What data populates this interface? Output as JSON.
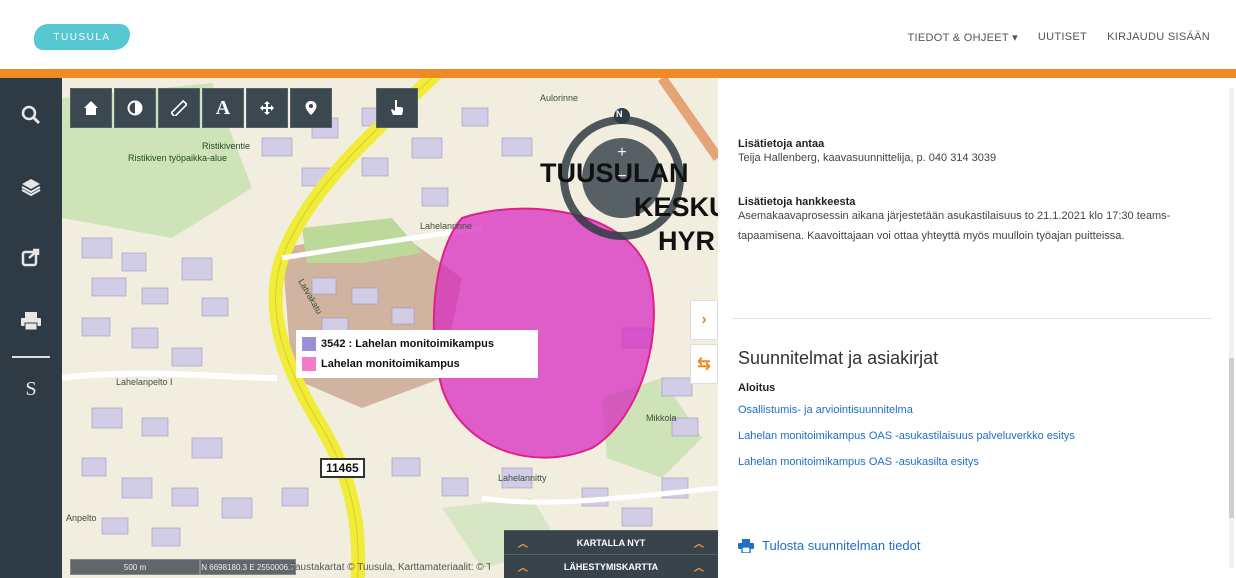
{
  "header": {
    "logo_text": "TUUSULA",
    "nav": [
      {
        "label": "TIEDOT & OHJEET ▾"
      },
      {
        "label": "UUTISET"
      },
      {
        "label": "KIRJAUDU SISÄÄN"
      }
    ],
    "accent_color": "#f08a24"
  },
  "sidebar": {
    "items": [
      {
        "icon": "search-icon"
      },
      {
        "icon": "layers-icon"
      },
      {
        "icon": "share-icon"
      },
      {
        "icon": "print-icon"
      },
      {
        "icon": "s-icon",
        "label": "S"
      }
    ]
  },
  "map": {
    "toolbar": [
      {
        "icon": "home-icon"
      },
      {
        "icon": "contrast-icon"
      },
      {
        "icon": "ruler-icon"
      },
      {
        "icon": "text-tool-icon",
        "label": "A"
      },
      {
        "icon": "move-icon"
      },
      {
        "icon": "location-pin-icon"
      },
      {
        "icon": "hand-pointer-icon"
      }
    ],
    "compass_label": "N",
    "place_labels": [
      "TUUSULAN",
      "KESKUS",
      "HYR"
    ],
    "small_labels": [
      "Ristikiven työpaikka-alue",
      "Ristikiventie",
      "Aulorinne",
      "Lahelanpelto I",
      "Lahelanrinne",
      "Mikkola",
      "Lahelannitty",
      "Anpelto",
      "Latvakatu"
    ],
    "legend": [
      {
        "label": "3542 : Lahelan monitoimikampus",
        "color": "#9b90d8"
      },
      {
        "label": "Lahelan monitoimikampus",
        "color": "#f47bc7"
      }
    ],
    "road_number": "11465",
    "scale_text": "500 m",
    "coords_text": "N 6698180.3 E 2550006.7",
    "copyright": "Taustakartat © Tuusula, Karttamateriaalit: © Tuusula",
    "bottom_panels": [
      {
        "label": "KARTALLA NYT"
      },
      {
        "label": "LÄHESTYMISKARTTA"
      }
    ],
    "highlight_color": "#d726c0"
  },
  "info": {
    "contact_heading": "Lisätietoja antaa",
    "contact_text": "Teija Hallenberg, kaavasuunnittelija, p. 040 314 3039",
    "project_heading": "Lisätietoja hankkeesta",
    "project_text": "Asemakaavaprosessin aikana järjestetään asukastilaisuus to 21.1.2021 klo 17:30 teams-tapaamisena. Kaavoittajaan voi ottaa yhteyttä myös muulloin työajan puitteissa.",
    "section_title": "Suunnitelmat ja asiakirjat",
    "subsection": "Aloitus",
    "links": [
      {
        "label": "Osallistumis- ja arviointisuunnitelma"
      },
      {
        "label": "Lahelan monitoimikampus OAS -asukastilaisuus palveluverkko esitys"
      },
      {
        "label": "Lahelan monitoimikampus OAS -asukasilta esitys"
      }
    ],
    "print_label": "Tulosta suunnitelman tiedot",
    "link_color": "#1f6fc5"
  }
}
